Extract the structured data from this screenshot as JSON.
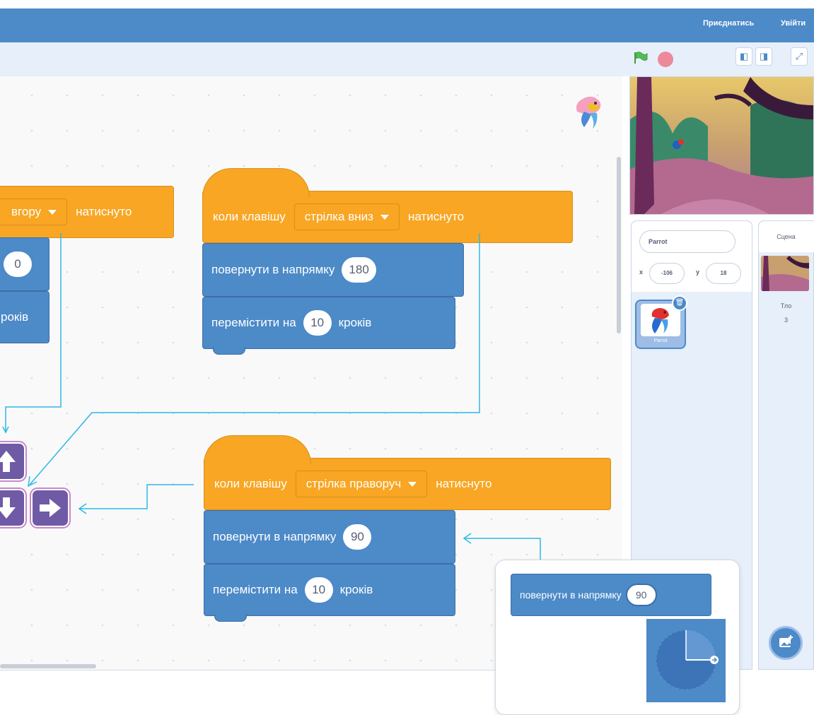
{
  "menubar": {
    "join": "Приєднатись",
    "signin": "Увійти"
  },
  "blocks": {
    "left_hat_partial": {
      "dropdown": "вгору",
      "suffix": "натиснуто"
    },
    "left_point_value": "0",
    "left_move_suffix": "років",
    "hat_down": {
      "prefix": "коли клавішу",
      "dropdown": "стрілка вниз",
      "suffix": "натиснуто"
    },
    "turn_down": {
      "label": "повернути в напрямку",
      "value": "180"
    },
    "move_down": {
      "label": "перемістити на",
      "value": "10",
      "suffix": "кроків"
    },
    "hat_right": {
      "prefix": "коли клавішу",
      "dropdown": "стрілка праворуч",
      "suffix": "натиснуто"
    },
    "turn_right": {
      "label": "повернути в напрямку",
      "value": "90"
    },
    "move_right": {
      "label": "перемістити на",
      "value": "10",
      "suffix": "кроків"
    }
  },
  "sprite_info": {
    "name": "Parrot",
    "x_label": "x",
    "x_value": "-106",
    "y_label": "y",
    "y_value": "18",
    "sprite_thumb_label": "Parrot"
  },
  "stage_pane": {
    "title": "Сцена",
    "backdrops_label": "Тло",
    "backdrops_count": "3"
  },
  "popup": {
    "label": "повернути в напрямку",
    "value": "90"
  },
  "colors": {
    "events": "#f8a623",
    "motion": "#4c8ac8",
    "accent": "#4c8ac8",
    "key": "#6f5aa6",
    "guide": "#2eb8e6"
  },
  "icons": [
    "green-flag-icon",
    "stop-icon",
    "small-stage-icon",
    "large-stage-icon",
    "fullscreen-icon",
    "arrow-up-key-icon",
    "arrow-down-key-icon",
    "arrow-right-key-icon",
    "trash-icon",
    "add-backdrop-icon",
    "parrot-sprite-icon"
  ]
}
